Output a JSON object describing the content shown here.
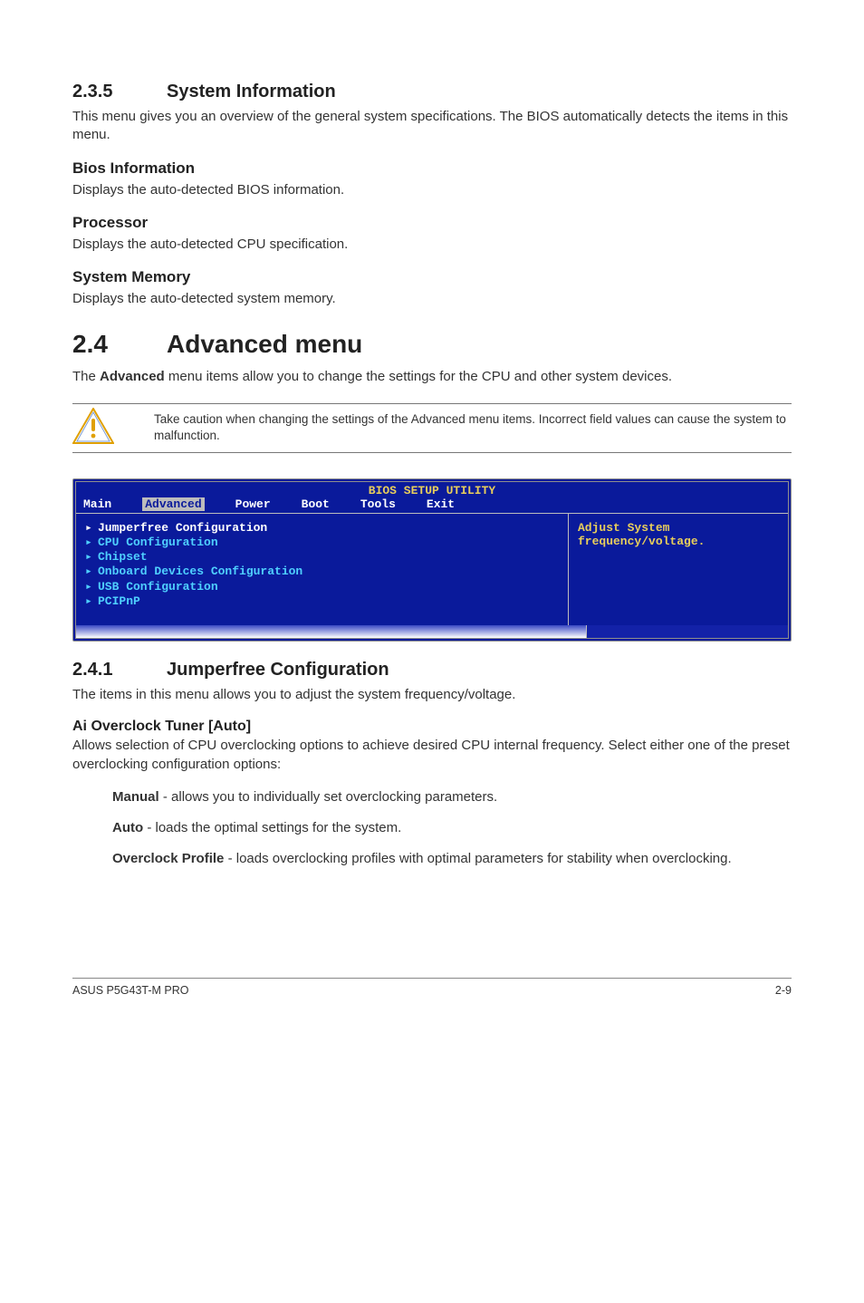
{
  "sec235": {
    "num": "2.3.5",
    "title": "System Information",
    "intro": "This menu gives you an overview of the general system specifications. The BIOS automatically detects the items in this menu.",
    "sub1": {
      "h": "Bios Information",
      "p": "Displays the auto-detected BIOS information."
    },
    "sub2": {
      "h": "Processor",
      "p": "Displays the auto-detected CPU specification."
    },
    "sub3": {
      "h": "System Memory",
      "p": "Displays the auto-detected system memory."
    }
  },
  "sec24": {
    "num": "2.4",
    "title": "Advanced menu",
    "intro": "The Advanced menu items allow you to change the settings for the CPU and other system devices.",
    "caution": "Take caution when changing the settings of the Advanced menu items. Incorrect field values can cause the system to malfunction."
  },
  "bios": {
    "title": "BIOS SETUP UTILITY",
    "tabs": [
      "Main",
      "Advanced",
      "Power",
      "Boot",
      "Tools",
      "Exit"
    ],
    "selected_tab": "Advanced",
    "items": [
      "Jumperfree Configuration",
      "CPU Configuration",
      "Chipset",
      "Onboard Devices Configuration",
      "USB Configuration",
      "PCIPnP"
    ],
    "selected_item": "Jumperfree Configuration",
    "help_line1": "Adjust System",
    "help_line2": "frequency/voltage."
  },
  "sec241": {
    "num": "2.4.1",
    "title": "Jumperfree Configuration",
    "intro": "The items in this menu allows you to adjust the system frequency/voltage.",
    "ai_h": "Ai Overclock Tuner [Auto]",
    "ai_p": "Allows selection of CPU overclocking options to achieve desired CPU internal frequency. Select either one of the preset overclocking configuration options:",
    "opts": {
      "manual": {
        "name": "Manual",
        "desc": " - allows you to individually set overclocking parameters."
      },
      "auto": {
        "name": "Auto",
        "desc": " - loads the optimal settings for the system."
      },
      "oc": {
        "name": "Overclock Profile",
        "desc": " - loads overclocking profiles with optimal parameters for stability when overclocking."
      }
    }
  },
  "footer": {
    "left": "ASUS P5G43T-M PRO",
    "right": "2-9"
  }
}
